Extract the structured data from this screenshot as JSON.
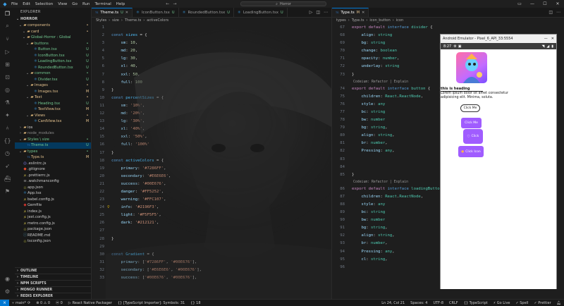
{
  "titlebar": {
    "menu": [
      "File",
      "Edit",
      "Selection",
      "View",
      "Go",
      "Run",
      "Terminal",
      "Help"
    ],
    "search": "Horror"
  },
  "sidebar": {
    "title": "EXPLORER",
    "root": "HORROR",
    "items": [
      {
        "label": "components",
        "depth": 1,
        "type": "folder-open",
        "badge": "•",
        "color": "#e2c08d"
      },
      {
        "label": "card",
        "depth": 2,
        "type": "folder-open",
        "badge": "•",
        "color": "#e2c08d"
      },
      {
        "label": "Global-Horror : Global",
        "depth": 2,
        "type": "folder-open",
        "badge": "",
        "color": "#73c991"
      },
      {
        "label": "buttons",
        "depth": 3,
        "type": "folder-open",
        "badge": "•",
        "color": "#73c991"
      },
      {
        "label": "Button.tsx",
        "depth": 4,
        "type": "tsx",
        "badge": "U",
        "color": "#73c991"
      },
      {
        "label": "IconButton.tsx",
        "depth": 4,
        "type": "tsx",
        "badge": "U",
        "color": "#73c991"
      },
      {
        "label": "LoadingButton.tsx",
        "depth": 4,
        "type": "tsx",
        "badge": "U",
        "color": "#73c991"
      },
      {
        "label": "RoundedButton.tsx",
        "depth": 4,
        "type": "tsx",
        "badge": "U",
        "color": "#73c991"
      },
      {
        "label": "common",
        "depth": 3,
        "type": "folder-open",
        "badge": "•",
        "color": "#73c991"
      },
      {
        "label": "Divider.tsx",
        "depth": 4,
        "type": "tsx",
        "badge": "U",
        "color": "#73c991"
      },
      {
        "label": "Images",
        "depth": 3,
        "type": "folder-open",
        "badge": "•",
        "color": "#e2c08d"
      },
      {
        "label": "Images.tsx",
        "depth": 4,
        "type": "tsx",
        "badge": "M",
        "color": "#e2c08d"
      },
      {
        "label": "Text",
        "depth": 3,
        "type": "folder-open",
        "badge": "•",
        "color": "#e2c08d"
      },
      {
        "label": "Heading.tsx",
        "depth": 4,
        "type": "tsx",
        "badge": "U",
        "color": "#73c991"
      },
      {
        "label": "TextView.tsx",
        "depth": 4,
        "type": "tsx",
        "badge": "M",
        "color": "#e2c08d"
      },
      {
        "label": "Views",
        "depth": 3,
        "type": "folder-open",
        "badge": "•",
        "color": "#e2c08d"
      },
      {
        "label": "CardView.tsx",
        "depth": 4,
        "type": "tsx",
        "badge": "M",
        "color": "#e2c08d"
      },
      {
        "label": "ios",
        "depth": 1,
        "type": "folder",
        "badge": "",
        "color": "#cccccc"
      },
      {
        "label": "node_modules",
        "depth": 1,
        "type": "folder",
        "badge": "",
        "color": "#8c8c8c"
      },
      {
        "label": "Styles \\ size",
        "depth": 1,
        "type": "folder-open",
        "badge": "•",
        "color": "#73c991"
      },
      {
        "label": "Theme.ts",
        "depth": 2,
        "type": "ts",
        "badge": "U",
        "color": "#73c991",
        "selected": true
      },
      {
        "label": "types",
        "depth": 1,
        "type": "folder-open",
        "badge": "•",
        "color": "#73c991"
      },
      {
        "label": "Type.ts",
        "depth": 2,
        "type": "ts",
        "badge": "M",
        "color": "#e2c08d"
      },
      {
        "label": ".eslintrc.js",
        "depth": 1,
        "type": "eslint",
        "badge": "",
        "color": "#cccccc"
      },
      {
        "label": ".gitignore",
        "depth": 1,
        "type": "git",
        "badge": "",
        "color": "#cccccc"
      },
      {
        "label": ".prettierrc.js",
        "depth": 1,
        "type": "js",
        "badge": "",
        "color": "#cccccc"
      },
      {
        "label": ".watchmanconfig",
        "depth": 1,
        "type": "file",
        "badge": "",
        "color": "#cccccc"
      },
      {
        "label": "app.json",
        "depth": 1,
        "type": "json",
        "badge": "",
        "color": "#cccccc"
      },
      {
        "label": "App.tsx",
        "depth": 1,
        "type": "tsx",
        "badge": "",
        "color": "#cccccc"
      },
      {
        "label": "babel.config.js",
        "depth": 1,
        "type": "js",
        "badge": "",
        "color": "#cccccc"
      },
      {
        "label": "Gemfile",
        "depth": 1,
        "type": "gem",
        "badge": "",
        "color": "#cccccc"
      },
      {
        "label": "index.js",
        "depth": 1,
        "type": "js",
        "badge": "",
        "color": "#cccccc"
      },
      {
        "label": "jest.config.js",
        "depth": 1,
        "type": "js",
        "badge": "",
        "color": "#cccccc"
      },
      {
        "label": "metro.config.js",
        "depth": 1,
        "type": "js",
        "badge": "",
        "color": "#cccccc"
      },
      {
        "label": "package.json",
        "depth": 1,
        "type": "json",
        "badge": "",
        "color": "#cccccc"
      },
      {
        "label": "README.md",
        "depth": 1,
        "type": "md",
        "badge": "",
        "color": "#cccccc"
      },
      {
        "label": "tsconfig.json",
        "depth": 1,
        "type": "json",
        "badge": "",
        "color": "#cccccc"
      }
    ],
    "panels": [
      "OUTLINE",
      "TIMELINE",
      "NPM SCRIPTS",
      "MONGO RUNNER",
      "REDIS EXPLORER"
    ]
  },
  "editor1": {
    "tabs": [
      {
        "label": "Theme.ts",
        "mod": "U",
        "active": true
      },
      {
        "label": "IconButton.tsx",
        "mod": "U",
        "active": false
      },
      {
        "label": "RoundedButton.tsx",
        "mod": "U",
        "active": false
      },
      {
        "label": "LoadingButton.tsx",
        "mod": "U",
        "active": false
      }
    ],
    "breadcrumb": [
      "Styles",
      "size",
      "Theme.ts",
      "activeColors"
    ],
    "lines": [
      {
        "n": "",
        "t": ""
      },
      {
        "n": "",
        "t": "const sizes = {"
      },
      {
        "n": "",
        "t": "    sm: 10,"
      },
      {
        "n": "",
        "t": "    md: 20,"
      },
      {
        "n": "",
        "t": "    lg: 30,"
      },
      {
        "n": "",
        "t": "    xl: 40,"
      },
      {
        "n": "",
        "t": "    xxl: 50,"
      },
      {
        "n": "",
        "t": "    full: 100"
      },
      {
        "n": "",
        "t": "}"
      },
      {
        "n": "",
        "t": "const percentSizes = {"
      },
      {
        "n": "",
        "t": "    sm: '10%',"
      },
      {
        "n": "",
        "t": "    md: '20%',"
      },
      {
        "n": "",
        "t": "    lg: '30%',"
      },
      {
        "n": "",
        "t": "    xl: '40%',"
      },
      {
        "n": "",
        "t": "    xxl: '50%',"
      },
      {
        "n": "",
        "t": "    full: '100%'"
      },
      {
        "n": "",
        "t": "}"
      },
      {
        "n": "",
        "t": "const activeColors = {"
      },
      {
        "n": "",
        "t": "    primary: '#7286FF',"
      },
      {
        "n": "",
        "t": "    secondary: '#E6E6E6',"
      },
      {
        "n": "",
        "t": "    success: '#00E676',"
      },
      {
        "n": "",
        "t": "    danger: '#FF5252',"
      },
      {
        "n": "",
        "t": "    warning: '#FFC107',"
      },
      {
        "n": "",
        "t": "    info: '#2196F3',"
      },
      {
        "n": "",
        "t": "    light: '#F5F5F5',"
      },
      {
        "n": "",
        "t": "    dark: '#212121',"
      },
      {
        "n": "",
        "t": ""
      },
      {
        "n": "",
        "t": "}"
      },
      {
        "n": "",
        "t": ""
      },
      {
        "n": "",
        "t": "const Gradient = {"
      },
      {
        "n": "",
        "t": "    primary: ['#7286FF', '#00E676'],"
      },
      {
        "n": "",
        "t": "    secondary: ['#E6E6E6', '#00E676'],"
      },
      {
        "n": "",
        "t": "    success: ['#00E676', '#00E676'],"
      }
    ]
  },
  "editor2": {
    "tabs": [
      {
        "label": "Type.ts",
        "mod": "M",
        "active": true
      }
    ],
    "breadcrumb": [
      "types",
      "Type.ts",
      "icon_button",
      "icon"
    ],
    "lens1": "Codeium: Refactor | Explain",
    "lens2": "Codeium: Refactor | Explain",
    "lines": [
      {
        "n": "67",
        "t": "export default interface divider {"
      },
      {
        "n": "68",
        "t": "    align: string"
      },
      {
        "n": "69",
        "t": "    bg: string"
      },
      {
        "n": "70",
        "t": "    change: boolean"
      },
      {
        "n": "71",
        "t": "    opacity: number,"
      },
      {
        "n": "72",
        "t": "    underlay: string"
      },
      {
        "n": "73",
        "t": "}"
      },
      {
        "n": "",
        "t": "__LENS1__"
      },
      {
        "n": "74",
        "t": "export default interface button {"
      },
      {
        "n": "75",
        "t": "    children: React.ReactNode,"
      },
      {
        "n": "76",
        "t": "    style: any"
      },
      {
        "n": "77",
        "t": "    bc: string"
      },
      {
        "n": "78",
        "t": "    bw: number"
      },
      {
        "n": "79",
        "t": "    bg: string,"
      },
      {
        "n": "80",
        "t": "    align: string,"
      },
      {
        "n": "81",
        "t": "    br: number,"
      },
      {
        "n": "82",
        "t": "    Pressing: any,"
      },
      {
        "n": "83",
        "t": ""
      },
      {
        "n": "84",
        "t": ""
      },
      {
        "n": "85",
        "t": "}"
      },
      {
        "n": "",
        "t": "__LENS2__"
      },
      {
        "n": "86",
        "t": "export default interface loadingButton {"
      },
      {
        "n": "87",
        "t": "    children: React.ReactNode,"
      },
      {
        "n": "88",
        "t": "    style: any"
      },
      {
        "n": "89",
        "t": "    bc: string"
      },
      {
        "n": "90",
        "t": "    bw: number"
      },
      {
        "n": "91",
        "t": "    bg: string,"
      },
      {
        "n": "92",
        "t": "    align: string,"
      },
      {
        "n": "93",
        "t": "    br: number,"
      },
      {
        "n": "94",
        "t": "    Pressing: any,"
      },
      {
        "n": "95",
        "t": "    cl: string,"
      },
      {
        "n": "96",
        "t": ""
      }
    ]
  },
  "emulator": {
    "title": "Android Emulator - Pixel_6_API_33:5554",
    "time": "8:27",
    "heading": "this is heading",
    "paragraph": "Lorem ipsum dolor sit amet consectetur adipisicing elit. Minima, soluta.",
    "btn_click": "Click Me",
    "btn_click2": "Click Me",
    "btn_click3": "Click",
    "btn_icon": "Click Icon",
    "accent": "#a05cff"
  },
  "statusbar": {
    "branch": "main*",
    "sync": "⟳",
    "problems": "⊗ 0 ⚠ 0",
    "ports": "ⓦ 0",
    "packager": "React Native Packager",
    "ts_import": "{} [TypeScript Importer]: Symbols: 31",
    "count": "{} 18",
    "position": "Ln 24, Col 21",
    "spaces": "Spaces: 4",
    "encoding": "UTF-8",
    "eol": "CRLF",
    "language": "{} TypeScript",
    "golive": "⚡ Go Live",
    "spell": "✓ Spell",
    "prettier": "✓ Prettier"
  }
}
